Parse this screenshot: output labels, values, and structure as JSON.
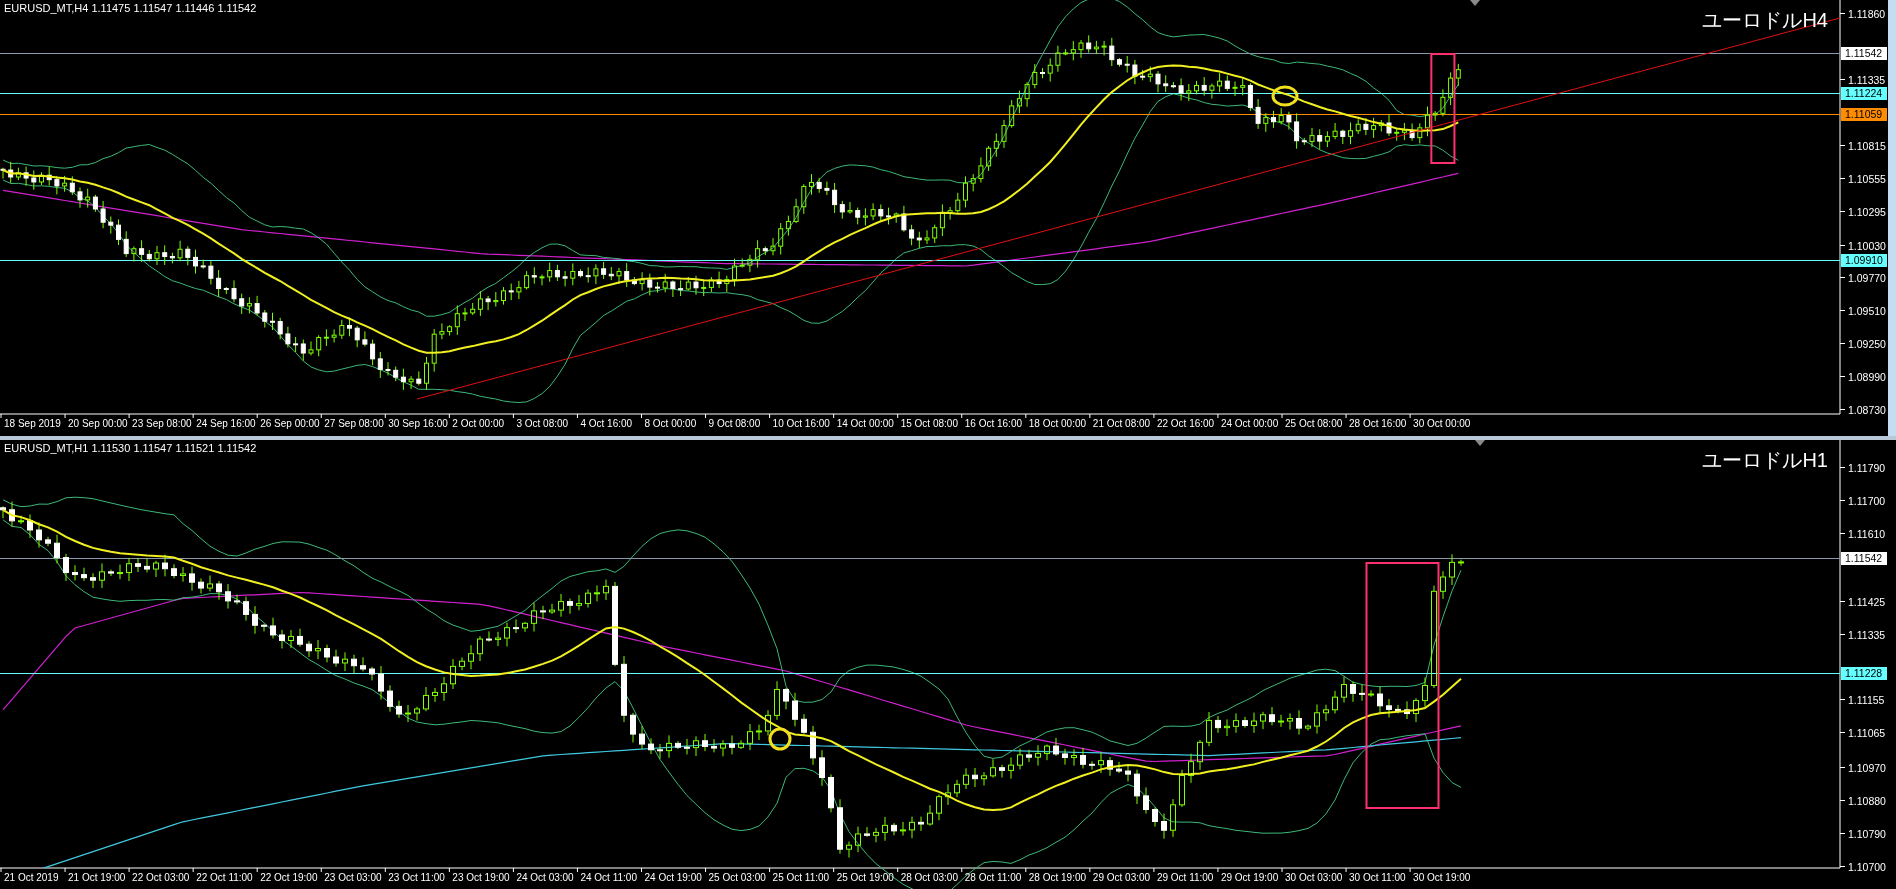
{
  "charts": [
    {
      "header": "EURUSD_MT,H4 1.11475 1.11547 1.11446 1.11542",
      "title": "ユーロドルH4",
      "price_ticks": [
        "1.11860",
        "1.11335",
        "1.10815",
        "1.10555",
        "1.10295",
        "1.10030",
        "1.09770",
        "1.09510",
        "1.09250",
        "1.08990",
        "1.08730"
      ],
      "price_lines": [
        {
          "label": "1.11542",
          "kind": "bid",
          "color": "#ffffff"
        },
        {
          "label": "1.11224",
          "kind": "level",
          "color": "#66ffff"
        },
        {
          "label": "1.11059",
          "kind": "level",
          "color": "#ff8c00"
        },
        {
          "label": "1.09910",
          "kind": "level",
          "color": "#66ffff"
        }
      ],
      "time_labels": [
        "18 Sep 2019",
        "20 Sep 00:00",
        "23 Sep 08:00",
        "24 Sep 16:00",
        "26 Sep 00:00",
        "27 Sep 08:00",
        "30 Sep 16:00",
        "2 Oct 00:00",
        "3 Oct 08:00",
        "4 Oct 16:00",
        "8 Oct 00:00",
        "9 Oct 08:00",
        "10 Oct 16:00",
        "14 Oct 00:00",
        "15 Oct 08:00",
        "16 Oct 16:00",
        "18 Oct 00:00",
        "21 Oct 08:00",
        "22 Oct 16:00",
        "24 Oct 00:00",
        "25 Oct 08:00",
        "28 Oct 16:00",
        "30 Oct 00:00"
      ]
    },
    {
      "header": "EURUSD_MT,H1 1.11530 1.11547 1.11521 1.11542",
      "title": "ユーロドルH1",
      "price_ticks": [
        "1.11790",
        "1.11700",
        "1.11610",
        "1.11425",
        "1.11335",
        "1.11155",
        "1.11065",
        "1.10970",
        "1.10880",
        "1.10790",
        "1.10700"
      ],
      "price_lines": [
        {
          "label": "1.11542",
          "kind": "bid",
          "color": "#ffffff"
        },
        {
          "label": "1.11228",
          "kind": "level",
          "color": "#66ffff"
        }
      ],
      "time_labels": [
        "21 Oct 2019",
        "21 Oct 19:00",
        "22 Oct 03:00",
        "22 Oct 11:00",
        "22 Oct 19:00",
        "23 Oct 03:00",
        "23 Oct 11:00",
        "23 Oct 19:00",
        "24 Oct 03:00",
        "24 Oct 11:00",
        "24 Oct 19:00",
        "25 Oct 03:00",
        "25 Oct 11:00",
        "25 Oct 19:00",
        "28 Oct 03:00",
        "28 Oct 11:00",
        "28 Oct 19:00",
        "29 Oct 03:00",
        "29 Oct 11:00",
        "29 Oct 19:00",
        "30 Oct 03:00",
        "30 Oct 11:00",
        "30 Oct 19:00"
      ]
    }
  ]
}
